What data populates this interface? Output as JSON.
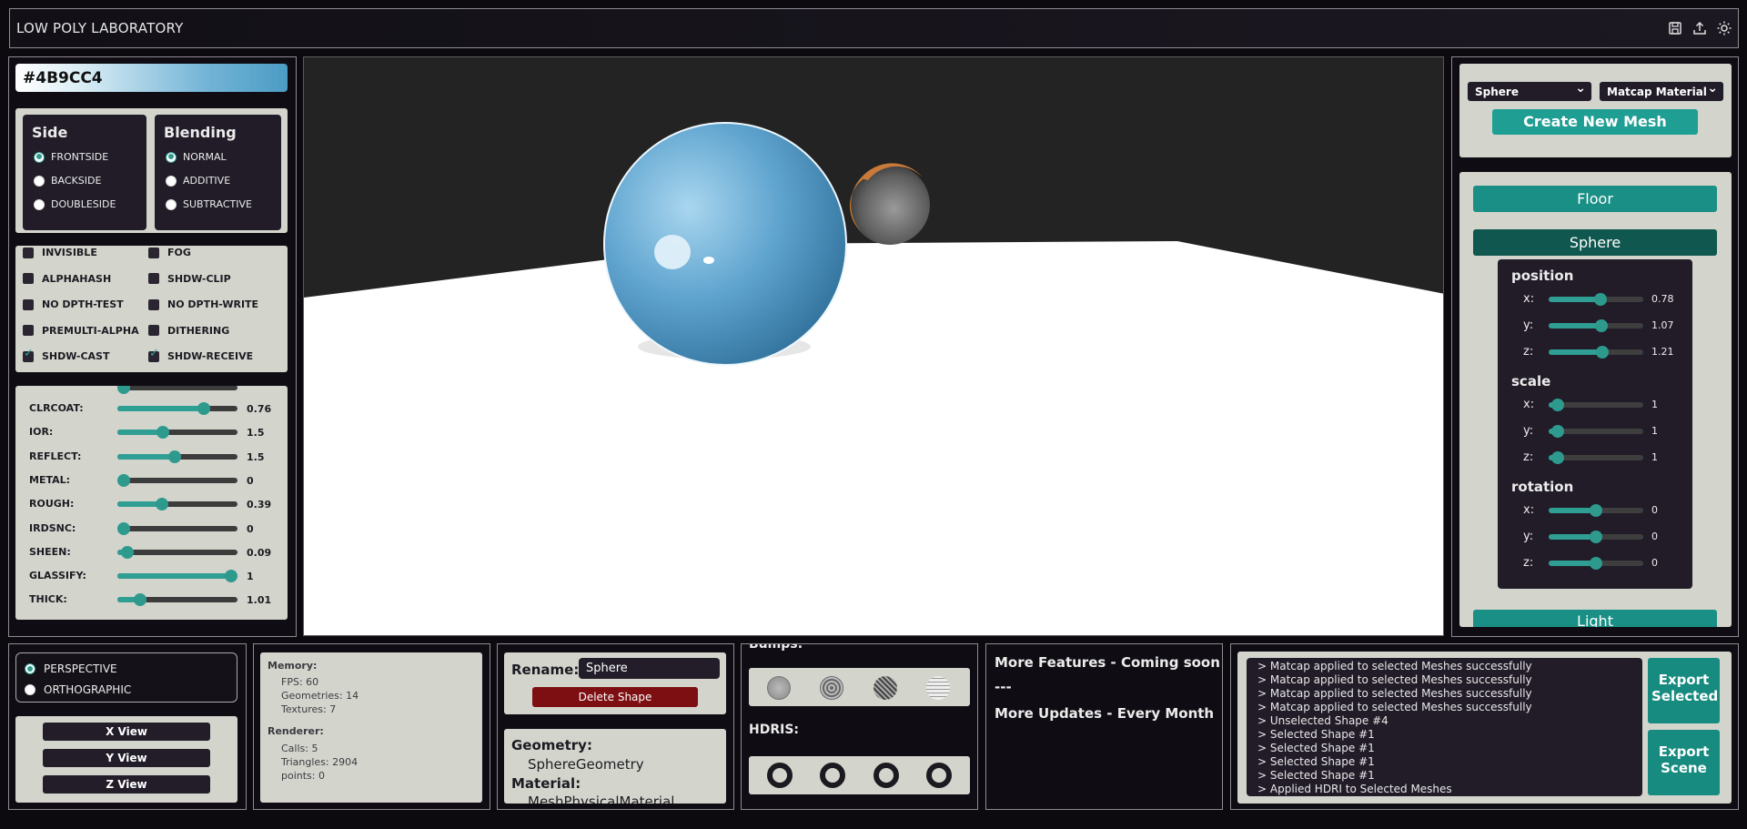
{
  "app": {
    "title": "LOW POLY LABORATORY",
    "icons": [
      "save-icon",
      "export-icon",
      "sun-icon"
    ]
  },
  "color": {
    "hex": "#4B9CC4"
  },
  "side": {
    "title": "Side",
    "options": [
      "FRONTSIDE",
      "BACKSIDE",
      "DOUBLESIDE"
    ],
    "selected": "FRONTSIDE"
  },
  "blending": {
    "title": "Blending",
    "options": [
      "NORMAL",
      "ADDITIVE",
      "SUBTRACTIVE"
    ],
    "selected": "NORMAL"
  },
  "flags": [
    {
      "label": "INVISIBLE",
      "checked": false
    },
    {
      "label": "FOG",
      "checked": false
    },
    {
      "label": "ALPHAHASH",
      "checked": false
    },
    {
      "label": "SHDW-CLIP",
      "checked": false
    },
    {
      "label": "NO DPTH-TEST",
      "checked": false
    },
    {
      "label": "NO DPTH-WRITE",
      "checked": false
    },
    {
      "label": "PREMULTI-ALPHA",
      "checked": false
    },
    {
      "label": "DITHERING",
      "checked": false
    },
    {
      "label": "SHDW-CAST",
      "checked": true
    },
    {
      "label": "SHDW-RECEIVE",
      "checked": true
    }
  ],
  "material_props": [
    {
      "label": "CLRCOAT:",
      "value": "0.76",
      "frac": 0.76
    },
    {
      "label": "IOR:",
      "value": "1.5",
      "frac": 0.4
    },
    {
      "label": "REFLECT:",
      "value": "1.5",
      "frac": 0.5
    },
    {
      "label": "METAL:",
      "value": "0",
      "frac": 0
    },
    {
      "label": "ROUGH:",
      "value": "0.39",
      "frac": 0.39
    },
    {
      "label": "IRDSNC:",
      "value": "0",
      "frac": 0
    },
    {
      "label": "SHEEN:",
      "value": "0.09",
      "frac": 0.09
    },
    {
      "label": "GLASSIFY:",
      "value": "1",
      "frac": 1
    },
    {
      "label": "THICK:",
      "value": "1.01",
      "frac": 0.2
    }
  ],
  "mesh_create": {
    "shape": "Sphere",
    "material": "Matcap Material",
    "button": "Create New Mesh"
  },
  "scene_items": {
    "floor": "Floor",
    "sphere": "Sphere",
    "light": "Light"
  },
  "transform": {
    "position": {
      "title": "position",
      "x": "0.78",
      "y": "1.07",
      "z": "1.21",
      "fx": 0.55,
      "fy": 0.56,
      "fz": 0.57
    },
    "scale": {
      "title": "scale",
      "x": "1",
      "y": "1",
      "z": "1",
      "fx": 0.1,
      "fy": 0.1,
      "fz": 0.1
    },
    "rotation": {
      "title": "rotation",
      "x": "0",
      "y": "0",
      "z": "0",
      "fx": 0.5,
      "fy": 0.5,
      "fz": 0.5
    }
  },
  "camera": {
    "options": [
      "PERSPECTIVE",
      "ORTHOGRAPHIC"
    ],
    "selected": "PERSPECTIVE",
    "views": [
      "X View",
      "Y View",
      "Z View"
    ]
  },
  "stats": {
    "memory_title": "Memory:",
    "fps": "FPS: 60",
    "geometries": "Geometries: 14",
    "textures": "Textures: 7",
    "renderer_title": "Renderer:",
    "calls": "Calls: 5",
    "triangles": "Triangles: 2904",
    "points": "points: 0"
  },
  "rename": {
    "label": "Rename:",
    "value": "Sphere",
    "delete": "Delete Shape"
  },
  "info": {
    "geometry_title": "Geometry:",
    "geometry": "SphereGeometry",
    "material_title": "Material:",
    "material": "MeshPhysicalMaterial"
  },
  "textures": {
    "bumps_title": "Bumps:",
    "hdris_title": "HDRIS:"
  },
  "features": {
    "line1": "More Features - Coming soon",
    "line2": "---",
    "line3": "More Updates - Every Month"
  },
  "log": [
    "> Matcap applied to selected Meshes successfully",
    "> Matcap applied to selected Meshes successfully",
    "> Matcap applied to selected Meshes successfully",
    "> Matcap applied to selected Meshes successfully",
    "> Unselected Shape #4",
    "> Selected Shape #1",
    "> Selected Shape #1",
    "> Selected Shape #1",
    "> Selected Shape #1",
    "> Applied HDRI to Selected Meshes"
  ],
  "export": {
    "selected": "Export Selected",
    "scene": "Export Scene"
  },
  "colors": {
    "accent": "#2e9a8e",
    "accent_dark": "#10574f",
    "danger": "#7d0f12",
    "sphere": "#4b9cc4"
  }
}
